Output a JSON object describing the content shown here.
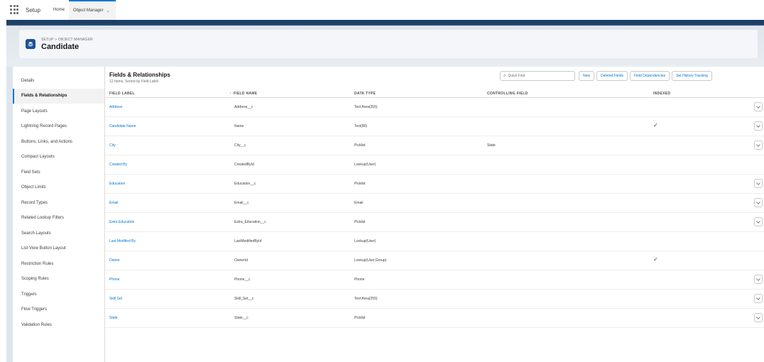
{
  "global_nav": {
    "app_name": "Setup",
    "tabs": [
      {
        "label": "Home",
        "active": false
      },
      {
        "label": "Object Manager",
        "active": true
      }
    ]
  },
  "page_header": {
    "breadcrumb": "SETUP > OBJECT MANAGER",
    "title": "Candidate",
    "icon": "layers-icon"
  },
  "sidebar": {
    "items": [
      {
        "label": "Details",
        "active": false
      },
      {
        "label": "Fields & Relationships",
        "active": true
      },
      {
        "label": "Page Layouts",
        "active": false
      },
      {
        "label": "Lightning Record Pages",
        "active": false
      },
      {
        "label": "Buttons, Links, and Actions",
        "active": false
      },
      {
        "label": "Compact Layouts",
        "active": false
      },
      {
        "label": "Field Sets",
        "active": false
      },
      {
        "label": "Object Limits",
        "active": false
      },
      {
        "label": "Record Types",
        "active": false
      },
      {
        "label": "Related Lookup Filters",
        "active": false
      },
      {
        "label": "Search Layouts",
        "active": false
      },
      {
        "label": "List View Button Layout",
        "active": false
      },
      {
        "label": "Restriction Rules",
        "active": false
      },
      {
        "label": "Scoping Rules",
        "active": false
      },
      {
        "label": "Triggers",
        "active": false
      },
      {
        "label": "Flow Triggers",
        "active": false
      },
      {
        "label": "Validation Rules",
        "active": false
      }
    ]
  },
  "main": {
    "title": "Fields & Relationships",
    "subtitle": "12 Items, Sorted by Field Label",
    "search_placeholder": "Quick Find",
    "buttons": [
      "New",
      "Deleted Fields",
      "Field Dependencies",
      "Set History Tracking"
    ],
    "columns": [
      "FIELD LABEL",
      "FIELD NAME",
      "DATA TYPE",
      "CONTROLLING FIELD",
      "INDEXED"
    ],
    "rows": [
      {
        "label": "Address",
        "name": "Address__c",
        "type": "Text Area(255)",
        "controlling": "",
        "indexed": false,
        "menu": true
      },
      {
        "label": "Candidate Name",
        "name": "Name",
        "type": "Text(80)",
        "controlling": "",
        "indexed": true,
        "menu": true
      },
      {
        "label": "City",
        "name": "City__c",
        "type": "Picklist",
        "controlling": "State",
        "indexed": false,
        "menu": true
      },
      {
        "label": "Created By",
        "name": "CreatedById",
        "type": "Lookup(User)",
        "controlling": "",
        "indexed": false,
        "menu": false
      },
      {
        "label": "Education",
        "name": "Education__c",
        "type": "Picklist",
        "controlling": "",
        "indexed": false,
        "menu": true
      },
      {
        "label": "Email",
        "name": "Email__c",
        "type": "Email",
        "controlling": "",
        "indexed": false,
        "menu": true
      },
      {
        "label": "Extra Education",
        "name": "Extra_Education__c",
        "type": "Picklist",
        "controlling": "",
        "indexed": false,
        "menu": true
      },
      {
        "label": "Last Modified By",
        "name": "LastModifiedById",
        "type": "Lookup(User)",
        "controlling": "",
        "indexed": false,
        "menu": false
      },
      {
        "label": "Owner",
        "name": "OwnerId",
        "type": "Lookup(User,Group)",
        "controlling": "",
        "indexed": true,
        "menu": false
      },
      {
        "label": "Phone",
        "name": "Phone__c",
        "type": "Phone",
        "controlling": "",
        "indexed": false,
        "menu": true
      },
      {
        "label": "Skill Set",
        "name": "Skill_Set__c",
        "type": "Text Area(255)",
        "controlling": "",
        "indexed": false,
        "menu": true
      },
      {
        "label": "State",
        "name": "State__c",
        "type": "Picklist",
        "controlling": "",
        "indexed": false,
        "menu": true
      }
    ]
  },
  "colors": {
    "brand_blue": "#0176d3",
    "band_dark": "#1e3f66"
  }
}
